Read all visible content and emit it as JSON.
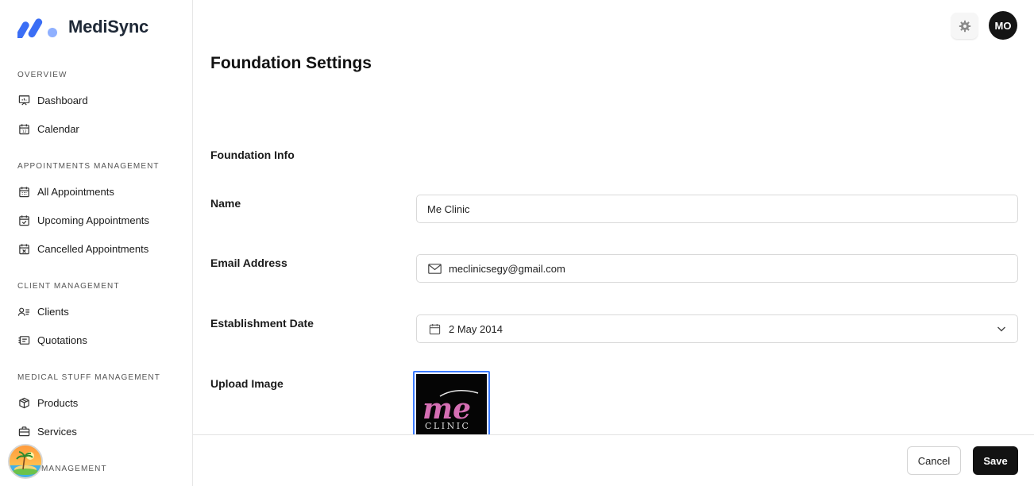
{
  "app": {
    "name": "MediSync"
  },
  "sidebar": {
    "sections": [
      {
        "title": "OVERVIEW",
        "items": [
          {
            "label": "Dashboard",
            "icon": "presentation-chart-icon"
          },
          {
            "label": "Calendar",
            "icon": "calendar-icon"
          }
        ]
      },
      {
        "title": "APPOINTMENTS MANAGEMENT",
        "items": [
          {
            "label": "All Appointments",
            "icon": "calendar-grid-icon"
          },
          {
            "label": "Upcoming Appointments",
            "icon": "calendar-check-icon"
          },
          {
            "label": "Cancelled Appointments",
            "icon": "calendar-x-icon"
          }
        ]
      },
      {
        "title": "CLIENT MANAGEMENT",
        "items": [
          {
            "label": "Clients",
            "icon": "user-list-icon"
          },
          {
            "label": "Quotations",
            "icon": "receipt-icon"
          }
        ]
      },
      {
        "title": "MEDICAL STUFF MANAGEMENT",
        "items": [
          {
            "label": "Products",
            "icon": "box-icon"
          },
          {
            "label": "Services",
            "icon": "briefcase-icon"
          }
        ]
      },
      {
        "title": "MANAGEMENT",
        "items": []
      }
    ]
  },
  "header": {
    "avatar_initials": "MO",
    "settings_icon": "gear-icon"
  },
  "main": {
    "title": "Foundation Settings",
    "section_title": "Foundation Info",
    "fields": {
      "name": {
        "label": "Name",
        "value": "Me Clinic"
      },
      "email": {
        "label": "Email Address",
        "value": "meclinicsegy@gmail.com",
        "icon": "mail-icon"
      },
      "establishment_date": {
        "label": "Establishment Date",
        "value": "2 May 2014",
        "icon": "calendar-icon"
      },
      "upload_image": {
        "label": "Upload Image",
        "logo_text": "me",
        "logo_subtext": "CLINIC"
      }
    }
  },
  "footer": {
    "cancel_label": "Cancel",
    "save_label": "Save"
  },
  "colors": {
    "brand_blue": "#3b6ef5",
    "brand_light": "#8fb0ff",
    "primary_button": "#121212",
    "focus_border": "#3b7bff"
  }
}
